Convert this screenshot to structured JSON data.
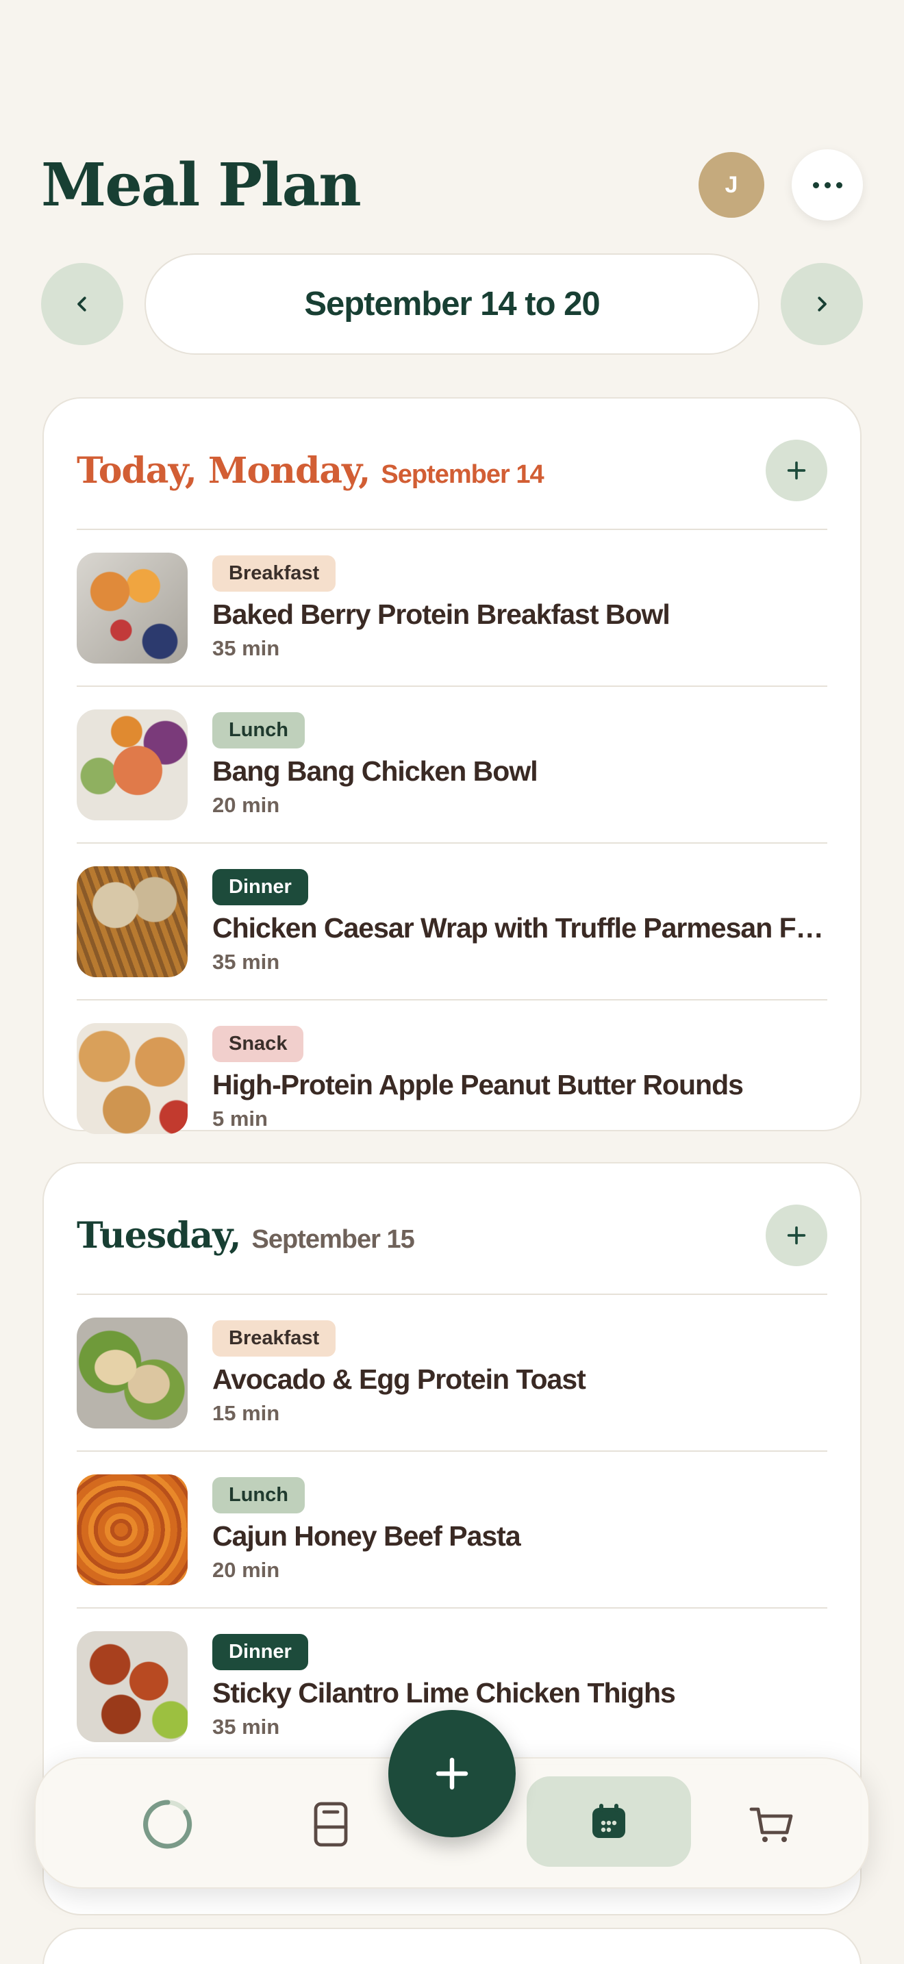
{
  "header": {
    "title": "Meal Plan",
    "avatar_initial": "J",
    "more_icon": "more-horizontal-icon"
  },
  "week_nav": {
    "label": "September 14 to 20",
    "prev_icon": "chevron-left-icon",
    "next_icon": "chevron-right-icon"
  },
  "days": [
    {
      "name": "Today, Monday,",
      "date": "September 14",
      "meals": [
        {
          "tag": "Breakfast",
          "name": "Baked Berry Protein Breakfast Bowl",
          "time": "35 min"
        },
        {
          "tag": "Lunch",
          "name": "Bang Bang Chicken Bowl",
          "time": "20 min"
        },
        {
          "tag": "Dinner",
          "name": "Chicken Caesar Wrap with Truffle Parmesan Fri…",
          "time": "35 min"
        },
        {
          "tag": "Snack",
          "name": "High-Protein Apple Peanut Butter Rounds",
          "time": "5 min"
        }
      ]
    },
    {
      "name": "Tuesday,",
      "date": "September 15",
      "meals": [
        {
          "tag": "Breakfast",
          "name": "Avocado & Egg Protein Toast",
          "time": "15 min"
        },
        {
          "tag": "Lunch",
          "name": "Cajun Honey Beef Pasta",
          "time": "20 min"
        },
        {
          "tag": "Dinner",
          "name": "Sticky Cilantro Lime Chicken Thighs",
          "time": "35 min"
        }
      ]
    }
  ],
  "bottom_nav": {
    "items": [
      "progress-icon",
      "recipe-book-icon",
      "calendar-icon",
      "cart-icon"
    ],
    "active": "calendar-icon",
    "fab_icon": "plus-icon"
  },
  "colors": {
    "background": "#f7f4ee",
    "primary": "#1d4b3b",
    "today_accent": "#d25e34",
    "chip_green": "#d8e2d4"
  }
}
